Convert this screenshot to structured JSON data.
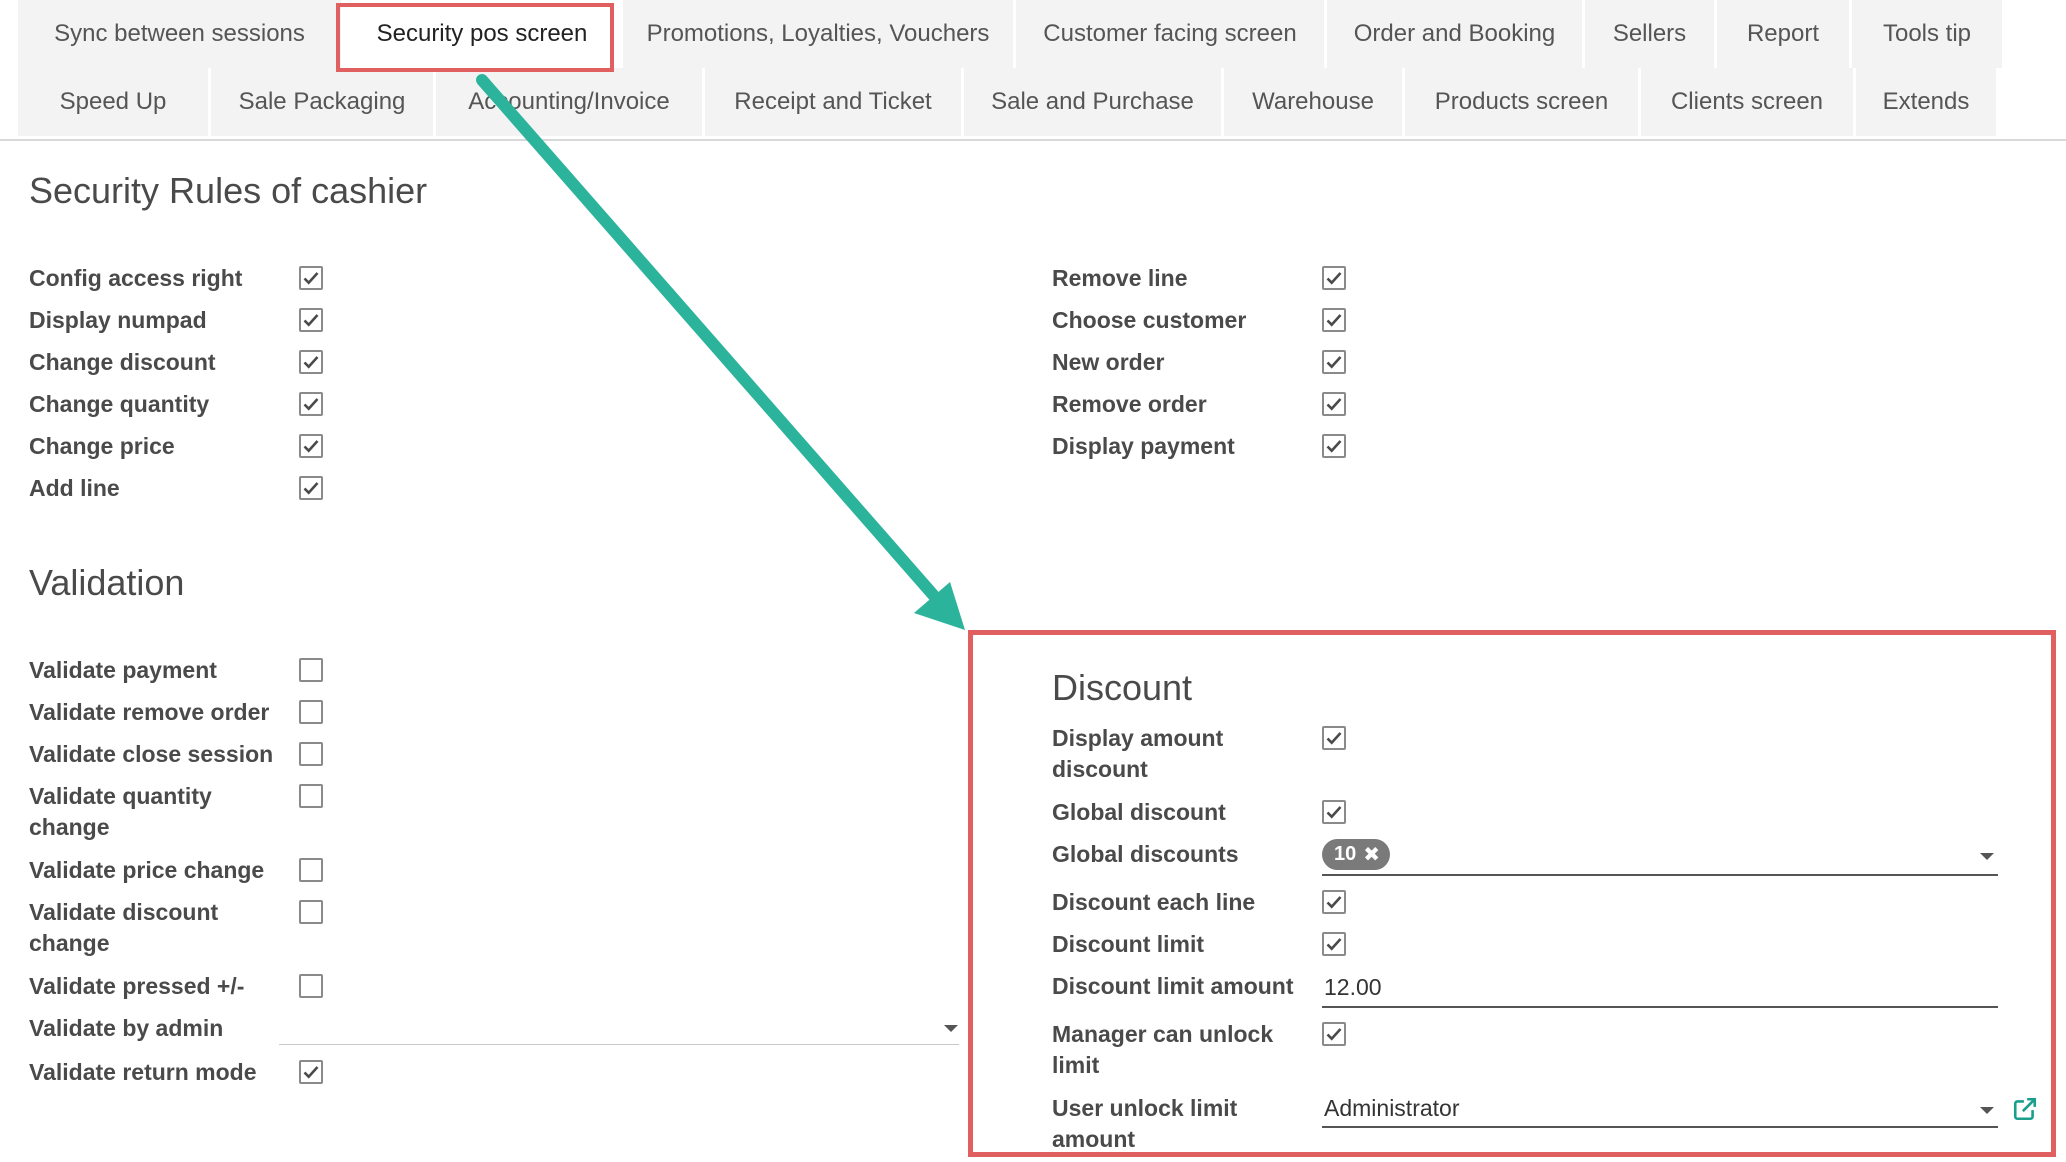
{
  "tabs": {
    "row1": [
      {
        "label": "Sync between sessions",
        "w": 323
      },
      {
        "label": "Security pos screen",
        "w": 276,
        "active": true
      },
      {
        "label": "Promotions, Loyalties, Vouchers",
        "w": 390
      },
      {
        "label": "Customer facing screen",
        "w": 308
      },
      {
        "label": "Order and Booking",
        "w": 255
      },
      {
        "label": "Sellers",
        "w": 129
      },
      {
        "label": "Report",
        "w": 132
      },
      {
        "label": "Tools tip",
        "w": 150
      }
    ],
    "row2": [
      {
        "label": "Speed Up",
        "w": 190
      },
      {
        "label": "Sale Packaging",
        "w": 222
      },
      {
        "label": "Accounting/Invoice",
        "w": 266
      },
      {
        "label": "Receipt and Ticket",
        "w": 256
      },
      {
        "label": "Sale and Purchase",
        "w": 257
      },
      {
        "label": "Warehouse",
        "w": 178
      },
      {
        "label": "Products screen",
        "w": 233
      },
      {
        "label": "Clients screen",
        "w": 212
      },
      {
        "label": "Extends",
        "w": 140
      }
    ]
  },
  "security": {
    "title": "Security Rules of cashier",
    "left": [
      {
        "label": "Config access right",
        "checked": true
      },
      {
        "label": "Display numpad",
        "checked": true
      },
      {
        "label": "Change discount",
        "checked": true
      },
      {
        "label": "Change quantity",
        "checked": true
      },
      {
        "label": "Change price",
        "checked": true
      },
      {
        "label": "Add line",
        "checked": true
      }
    ],
    "right": [
      {
        "label": "Remove line",
        "checked": true
      },
      {
        "label": "Choose customer",
        "checked": true
      },
      {
        "label": "New order",
        "checked": true
      },
      {
        "label": "Remove order",
        "checked": true
      },
      {
        "label": "Display payment",
        "checked": true
      }
    ]
  },
  "validation": {
    "title": "Validation",
    "items": [
      {
        "label": "Validate payment",
        "checked": false
      },
      {
        "label": "Validate remove order",
        "checked": false
      },
      {
        "label": "Validate close session",
        "checked": false
      },
      {
        "label": "Validate quantity change",
        "checked": false
      },
      {
        "label": "Validate price change",
        "checked": false
      },
      {
        "label": "Validate discount change",
        "checked": false
      },
      {
        "label": "Validate pressed +/-",
        "checked": false
      },
      {
        "label": "Validate by admin",
        "value": ""
      },
      {
        "label": "Validate return mode",
        "checked": true
      }
    ]
  },
  "discount": {
    "title": "Discount",
    "display_amount_discount": {
      "label": "Display amount discount",
      "checked": true
    },
    "global_discount": {
      "label": "Global discount",
      "checked": true
    },
    "global_discounts": {
      "label": "Global discounts",
      "tag": "10"
    },
    "discount_each_line": {
      "label": "Discount each line",
      "checked": true
    },
    "discount_limit": {
      "label": "Discount limit",
      "checked": true
    },
    "discount_limit_amount": {
      "label": "Discount limit amount",
      "value": "12.00"
    },
    "manager_can_unlock_limit": {
      "label": "Manager can unlock limit",
      "checked": true
    },
    "user_unlock_limit_amount": {
      "label": "User unlock limit amount",
      "value": "Administrator"
    }
  },
  "icons": {
    "check": "check-icon",
    "remove_tag": "close-icon",
    "dropdown": "chevron-down-icon",
    "external_link": "external-link-icon"
  },
  "colors": {
    "highlight": "#e05f5f",
    "arrow": "#2bb39b",
    "tag_bg": "#7a7a7a",
    "link_icon": "#1a9f8c"
  }
}
